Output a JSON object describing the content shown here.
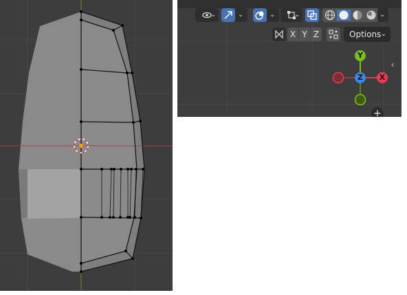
{
  "toolbar": {
    "visibility_icon": "eye-icon",
    "gizmo_icon": "gizmo-arrow-icon",
    "overlay_icon": "overlay-circles-icon",
    "mesh_edit_icon": "mesh-edit-icon",
    "xray_icon": "xray-icon",
    "shading_modes": [
      "wireframe-icon",
      "solid-icon",
      "material-icon",
      "rendered-icon"
    ],
    "active_shading": "solid-icon"
  },
  "mirror": {
    "icon": "butterfly-icon",
    "x_label": "X",
    "y_label": "Y",
    "z_label": "Z",
    "snap_icon": "snap-grid-icon"
  },
  "options": {
    "label": "Options",
    "caret": "⌄"
  },
  "gizmo": {
    "y_label": "Y",
    "z_label": "Z",
    "x_label": "X",
    "x_color": "#ea3a52",
    "y_color": "#7bbd20",
    "z_color": "#3d86e3"
  },
  "side_tab": "‹",
  "add_button": "+",
  "colors": {
    "viewport_bg": "#3d3d3d",
    "mesh_face": "#8c8c8c",
    "x_axis_line": "#b83a49",
    "y_axis_line": "#6b8a23",
    "accent_blue": "#4772b3"
  }
}
